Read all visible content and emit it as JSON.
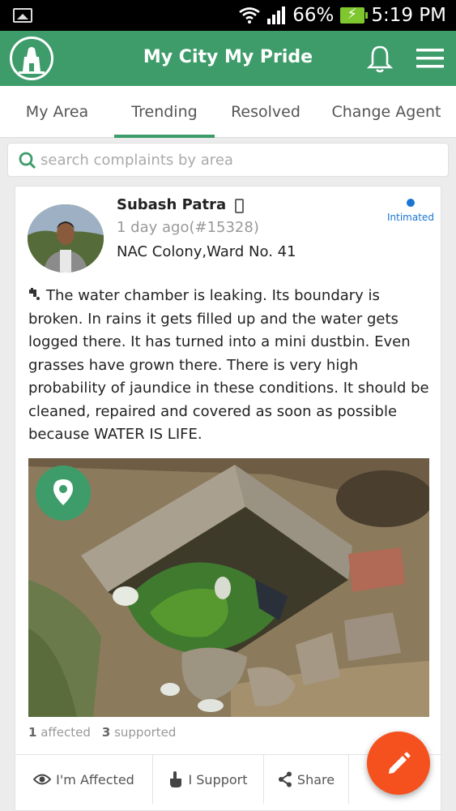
{
  "status_bar": {
    "battery": "66%",
    "time": "5:19 PM",
    "icons": [
      "image-icon",
      "wifi-icon",
      "signal-icon",
      "battery-charging-icon"
    ]
  },
  "app_bar": {
    "title": "My City My Pride",
    "logo": "temple-logo-icon",
    "notifications_icon": "bell-icon",
    "menu_icon": "hamburger-menu-icon",
    "color": "#3e9c6a"
  },
  "tabs": [
    {
      "label": "My Area",
      "active": false
    },
    {
      "label": "Trending",
      "active": true
    },
    {
      "label": "Resolved",
      "active": false
    },
    {
      "label": "Change Agent",
      "active": false
    }
  ],
  "search": {
    "placeholder": "search complaints by area",
    "icon": "search-icon"
  },
  "post": {
    "user_name": "Subash Patra",
    "time": "1 day ago(#15328)",
    "location": "NAC Colony,Ward No. 41",
    "status": "Intimated",
    "status_color": "#1976d2",
    "text": "The water chamber is leaking. Its boundary is broken. In rains it gets filled up and the water gets logged there. It has turned into a mini dustbin. Even grasses have grown there. There is very high probability of jaundice in these conditions. It should be cleaned, repaired and covered as soon as possible because WATER IS LIFE.",
    "affected_count": "1",
    "affected_label": "affected",
    "supported_count": "3",
    "supported_label": "supported",
    "actions": {
      "affected": "I'm Affected",
      "support": "I Support",
      "share": "Share"
    }
  },
  "fab": {
    "icon": "pencil-icon",
    "color": "#f4511e"
  }
}
